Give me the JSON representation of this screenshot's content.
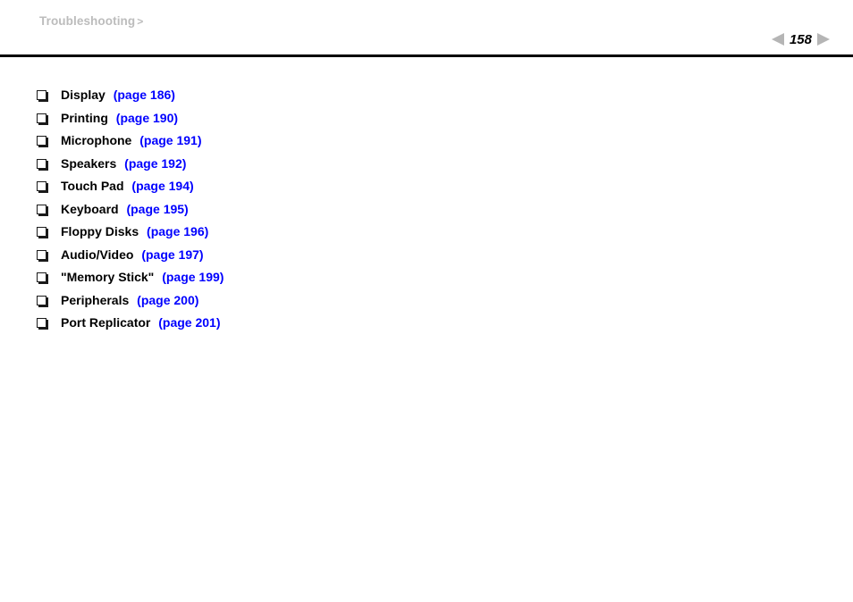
{
  "header": {
    "breadcrumb_label": "Troubleshooting",
    "breadcrumb_separator": ">",
    "prev_icon": "left-triangle-icon",
    "next_icon": "right-triangle-icon",
    "page_number": "158"
  },
  "colors": {
    "breadcrumb_gray": "#bcbcbc",
    "arrow_gray": "#b5b5b5",
    "link_blue": "#0000ff",
    "text_black": "#000000",
    "rule_black": "#000000",
    "background": "#ffffff"
  },
  "topics": [
    {
      "bullet": "hollow-square-bullet-icon",
      "label": "Display",
      "page_link": "(page 186)"
    },
    {
      "bullet": "hollow-square-bullet-icon",
      "label": "Printing",
      "page_link": "(page 190)"
    },
    {
      "bullet": "hollow-square-bullet-icon",
      "label": "Microphone",
      "page_link": "(page 191)"
    },
    {
      "bullet": "hollow-square-bullet-icon",
      "label": "Speakers",
      "page_link": "(page 192)"
    },
    {
      "bullet": "hollow-square-bullet-icon",
      "label": "Touch Pad",
      "page_link": "(page 194)"
    },
    {
      "bullet": "hollow-square-bullet-icon",
      "label": "Keyboard",
      "page_link": "(page 195)"
    },
    {
      "bullet": "hollow-square-bullet-icon",
      "label": "Floppy Disks",
      "page_link": "(page 196)"
    },
    {
      "bullet": "hollow-square-bullet-icon",
      "label": "Audio/Video",
      "page_link": "(page 197)"
    },
    {
      "bullet": "hollow-square-bullet-icon",
      "label": "\"Memory Stick\"",
      "page_link": "(page 199)"
    },
    {
      "bullet": "hollow-square-bullet-icon",
      "label": "Peripherals",
      "page_link": "(page 200)"
    },
    {
      "bullet": "hollow-square-bullet-icon",
      "label": "Port Replicator",
      "page_link": "(page 201)"
    }
  ]
}
